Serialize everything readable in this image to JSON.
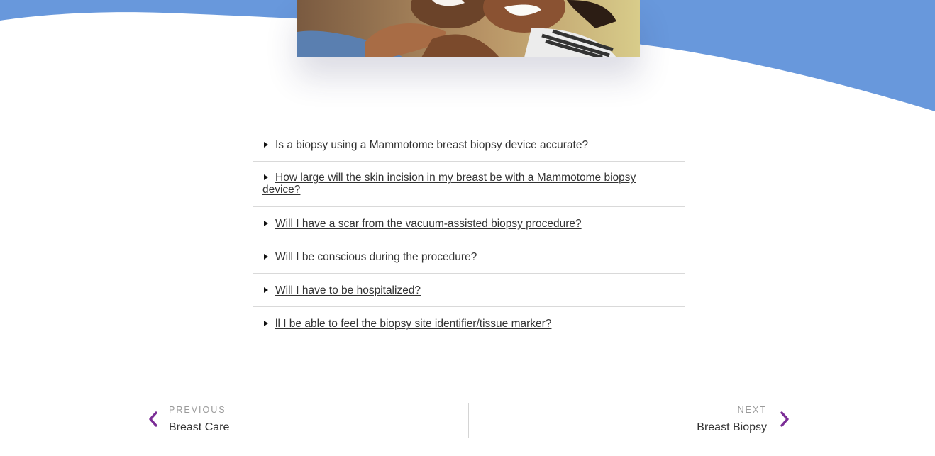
{
  "colors": {
    "wave": "#6898dc",
    "accent": "#7b2d96"
  },
  "faq": {
    "items": [
      {
        "question": "Is a biopsy using a Mammotome breast biopsy device accurate?"
      },
      {
        "question": "How large will the skin incision in my breast be with a Mammotome biopsy device?"
      },
      {
        "question": "Will I have a scar from the vacuum-assisted biopsy procedure?"
      },
      {
        "question": "Will I be conscious during the procedure?"
      },
      {
        "question": "Will I have to be hospitalized?"
      },
      {
        "question": "ll I be able to feel the biopsy site identifier/tissue marker?"
      }
    ]
  },
  "post_nav": {
    "previous": {
      "label": "PREVIOUS",
      "title": "Breast Care",
      "icon": "chevron-left-icon"
    },
    "next": {
      "label": "NEXT",
      "title": "Breast Biopsy",
      "icon": "chevron-right-icon"
    }
  }
}
